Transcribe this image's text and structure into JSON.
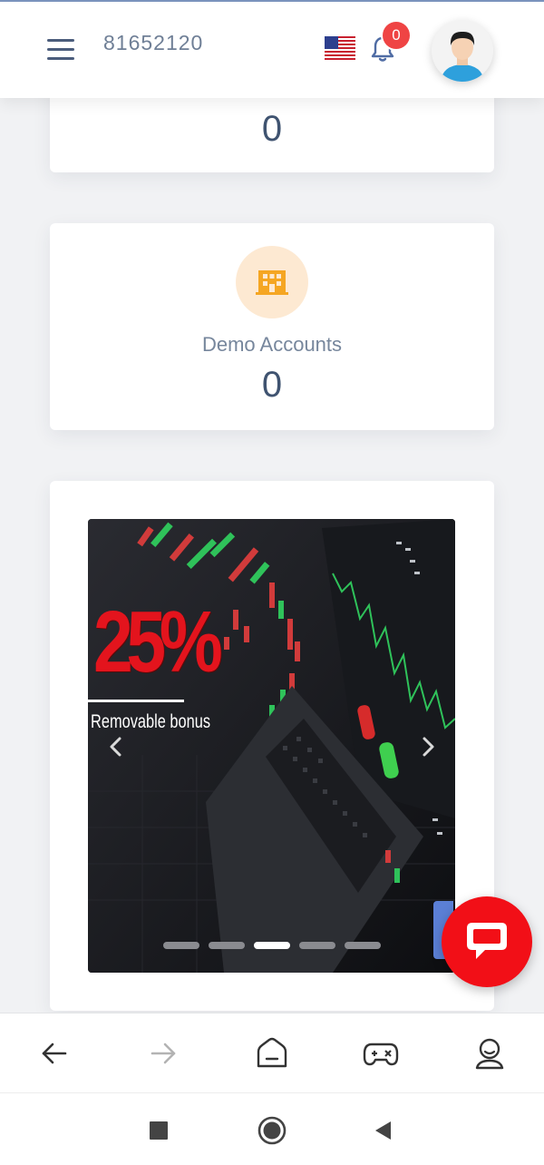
{
  "header": {
    "account_number": "81652120",
    "notification_count": "0",
    "icons": {
      "menu": "hamburger-menu-icon",
      "language": "us-flag-icon",
      "notifications": "bell-icon",
      "profile": "avatar"
    }
  },
  "stats": [
    {
      "label": "",
      "value": "0"
    },
    {
      "label": "Demo Accounts",
      "value": "0",
      "icon": "building-icon",
      "icon_color": "#f5a623",
      "icon_bg": "#fde9d2"
    }
  ],
  "promo": {
    "headline": "25%",
    "subtitle": "Removable bonus",
    "carousel": {
      "slide_count": 5,
      "active_slide": 3
    }
  },
  "bottom_nav": [
    "back-arrow-icon",
    "forward-arrow-icon",
    "home-icon",
    "gamepad-icon",
    "profile-icon"
  ],
  "system_nav": [
    "recents-square-icon",
    "home-circle-icon",
    "back-triangle-icon"
  ],
  "colors": {
    "accent_red": "#f20f17",
    "text_dark": "#3f5370",
    "text_muted": "#76869c",
    "badge_red": "#ef4444"
  }
}
